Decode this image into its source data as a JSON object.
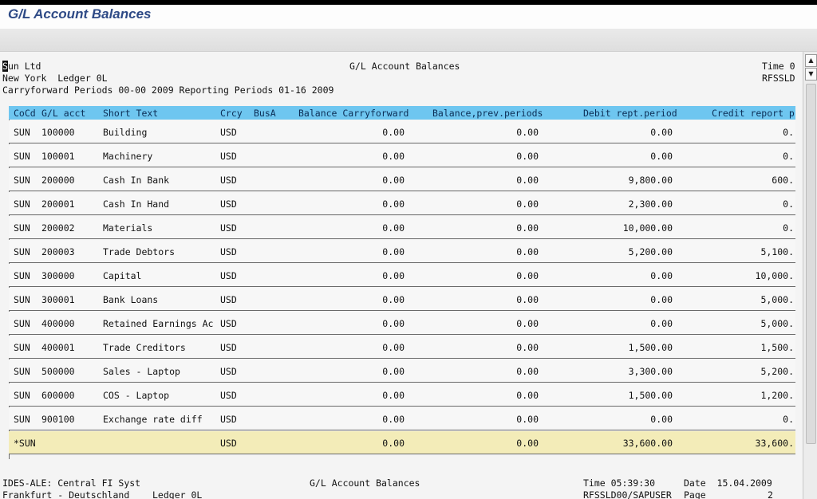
{
  "window": {
    "title": "G/L Account Balances"
  },
  "report_header": {
    "company": "Sun Ltd",
    "title": "G/L Account Balances",
    "time": "Time 0",
    "location_ledger": "New York  Ledger 0L",
    "program": "RFSSLD",
    "periods": "Carryforward Periods 00-00 2009 Reporting Periods 01-16 2009"
  },
  "columns": [
    "CoCd",
    "G/L acct",
    "Short Text",
    "Crcy",
    "BusA",
    "Balance Carryforward",
    "Balance,prev.periods",
    "Debit rept.period",
    "Credit report p"
  ],
  "rows": [
    {
      "cocd": "SUN",
      "acct": "100000",
      "text": "Building",
      "crcy": "USD",
      "bcf": "0.00",
      "bprev": "0.00",
      "debit": "0.00",
      "credit": "0."
    },
    {
      "cocd": "SUN",
      "acct": "100001",
      "text": "Machinery",
      "crcy": "USD",
      "bcf": "0.00",
      "bprev": "0.00",
      "debit": "0.00",
      "credit": "0."
    },
    {
      "cocd": "SUN",
      "acct": "200000",
      "text": "Cash In Bank",
      "crcy": "USD",
      "bcf": "0.00",
      "bprev": "0.00",
      "debit": "9,800.00",
      "credit": "600."
    },
    {
      "cocd": "SUN",
      "acct": "200001",
      "text": "Cash In Hand",
      "crcy": "USD",
      "bcf": "0.00",
      "bprev": "0.00",
      "debit": "2,300.00",
      "credit": "0."
    },
    {
      "cocd": "SUN",
      "acct": "200002",
      "text": "Materials",
      "crcy": "USD",
      "bcf": "0.00",
      "bprev": "0.00",
      "debit": "10,000.00",
      "credit": "0."
    },
    {
      "cocd": "SUN",
      "acct": "200003",
      "text": "Trade Debtors",
      "crcy": "USD",
      "bcf": "0.00",
      "bprev": "0.00",
      "debit": "5,200.00",
      "credit": "5,100."
    },
    {
      "cocd": "SUN",
      "acct": "300000",
      "text": "Capital",
      "crcy": "USD",
      "bcf": "0.00",
      "bprev": "0.00",
      "debit": "0.00",
      "credit": "10,000."
    },
    {
      "cocd": "SUN",
      "acct": "300001",
      "text": "Bank Loans",
      "crcy": "USD",
      "bcf": "0.00",
      "bprev": "0.00",
      "debit": "0.00",
      "credit": "5,000."
    },
    {
      "cocd": "SUN",
      "acct": "400000",
      "text": "Retained Earnings Ac",
      "crcy": "USD",
      "bcf": "0.00",
      "bprev": "0.00",
      "debit": "0.00",
      "credit": "5,000."
    },
    {
      "cocd": "SUN",
      "acct": "400001",
      "text": "Trade Creditors",
      "crcy": "USD",
      "bcf": "0.00",
      "bprev": "0.00",
      "debit": "1,500.00",
      "credit": "1,500."
    },
    {
      "cocd": "SUN",
      "acct": "500000",
      "text": "Sales - Laptop",
      "crcy": "USD",
      "bcf": "0.00",
      "bprev": "0.00",
      "debit": "3,300.00",
      "credit": "5,200."
    },
    {
      "cocd": "SUN",
      "acct": "600000",
      "text": "COS - Laptop",
      "crcy": "USD",
      "bcf": "0.00",
      "bprev": "0.00",
      "debit": "1,500.00",
      "credit": "1,200."
    },
    {
      "cocd": "SUN",
      "acct": "900100",
      "text": "Exchange rate diff",
      "crcy": "USD",
      "bcf": "0.00",
      "bprev": "0.00",
      "debit": "0.00",
      "credit": "0."
    }
  ],
  "total": {
    "cocd": "*SUN",
    "crcy": "USD",
    "bcf": "0.00",
    "bprev": "0.00",
    "debit": "33,600.00",
    "credit": "33,600."
  },
  "footer": {
    "system": "IDES-ALE: Central FI Syst",
    "title": "G/L Account Balances",
    "time": "Time 05:39:30",
    "date": "Date  15.04.2009",
    "location": "Frankfurt - Deutschland",
    "ledger": "Ledger 0L",
    "program_user": "RFSSLD00/SAPUSER",
    "page_label": "Page",
    "page_num": "2"
  },
  "colors": {
    "header_bg": "#6ec6f0",
    "total_bg": "#f3ecb8",
    "title_text": "#2e4a86"
  }
}
